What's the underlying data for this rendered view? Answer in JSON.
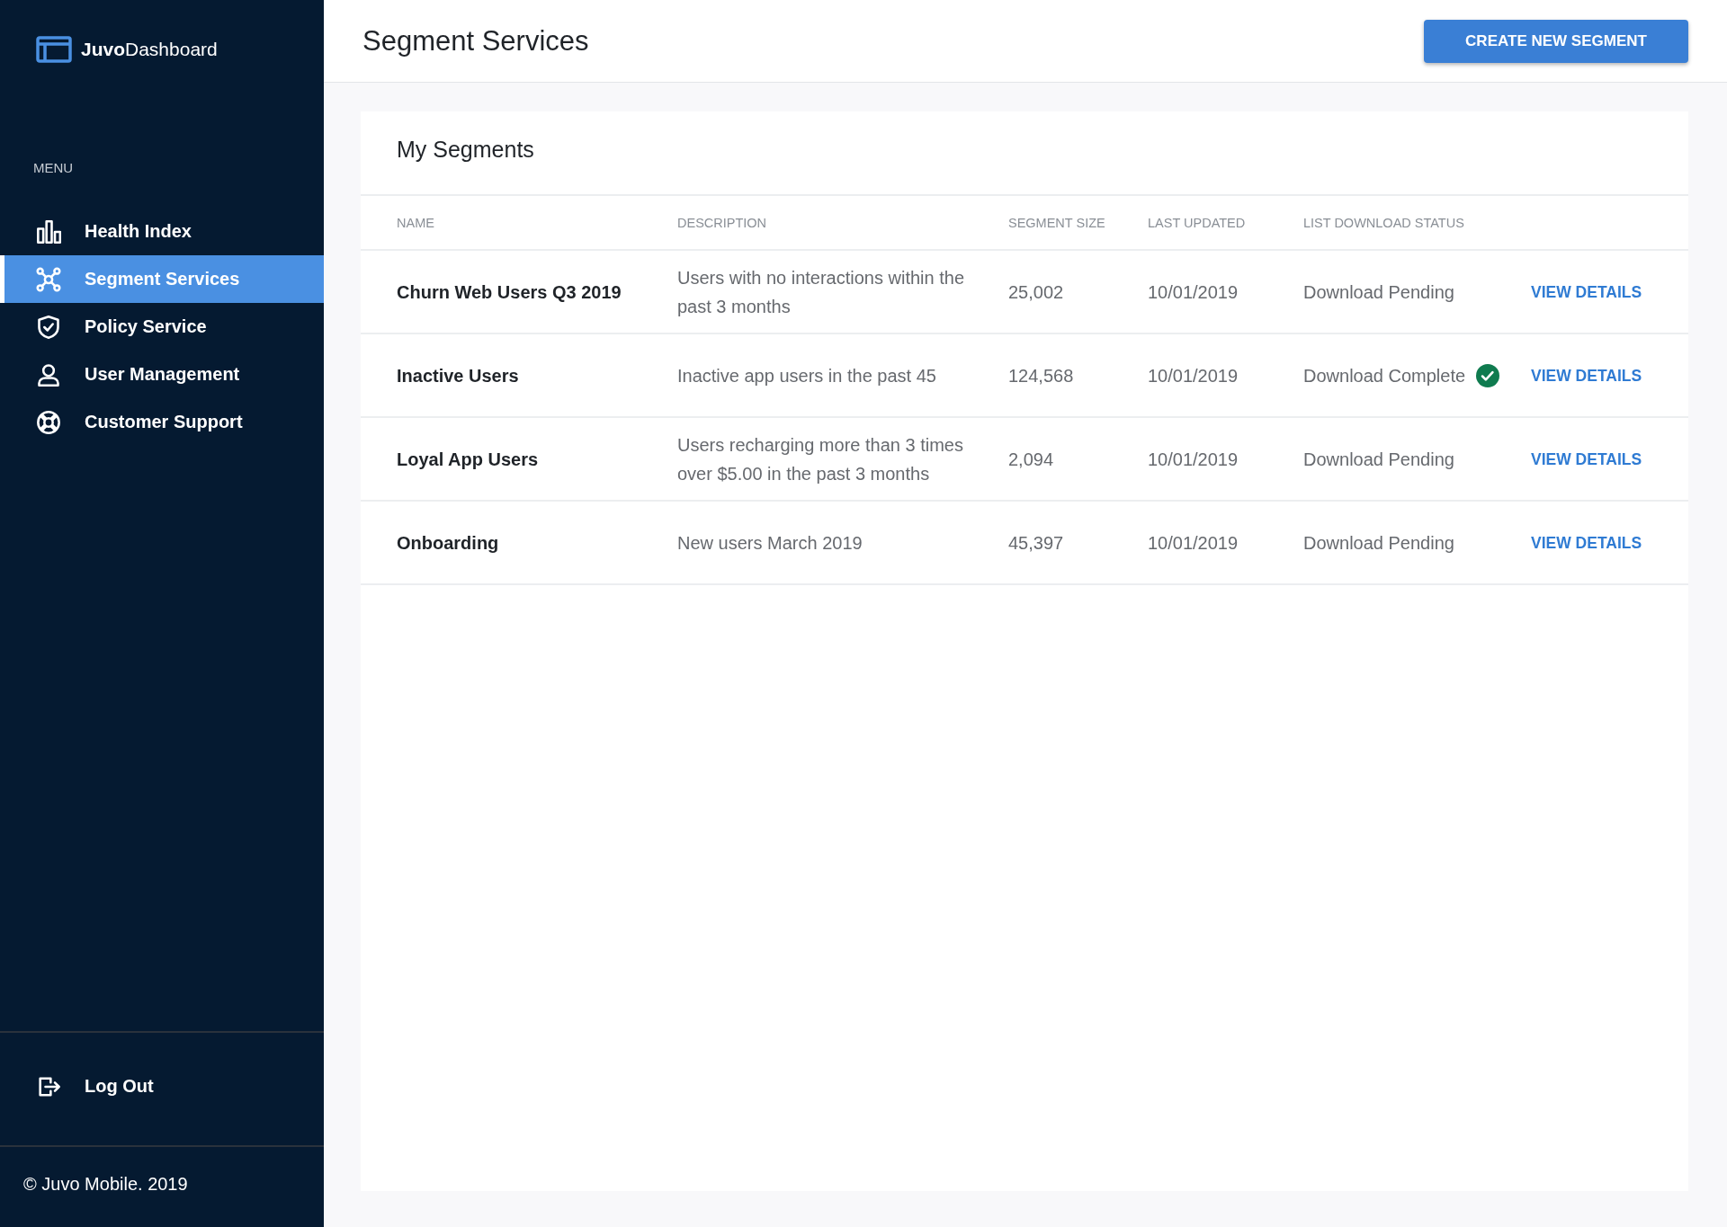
{
  "sidebar": {
    "logo": "**Juvo**Dashboard",
    "menu_label": "MENU",
    "items": [
      {
        "label": "Health Index",
        "kind": "bars",
        "selected": false
      },
      {
        "label": "Segment Services",
        "kind": "nodes",
        "selected": true
      },
      {
        "label": "Policy Service",
        "kind": "shield",
        "selected": false
      },
      {
        "label": "User Management",
        "kind": "user",
        "selected": false
      },
      {
        "label": "Customer Support",
        "kind": "lifebuoy",
        "selected": false
      }
    ],
    "logout": "Log Out",
    "footer": "© Juvo Mobile. 2019"
  },
  "header": {
    "title": "Segment Services",
    "button": "CREATE NEW SEGMENT"
  },
  "card": {
    "title": "My Segments",
    "columns": [
      "NAME",
      "DESCRIPTION",
      "SEGMENT SIZE",
      "LAST UPDATED",
      "LIST DOWNLOAD STATUS"
    ],
    "rows": [
      {
        "name": "Churn Web Users Q3 2019",
        "description": "Users with no interactions within the past 3 months",
        "size": "25,002",
        "updated": "10/01/2019",
        "status": "Download Pending",
        "complete": false,
        "action": "VIEW DETAILS"
      },
      {
        "name": "Inactive Users",
        "description": "Inactive app users in the past 45",
        "size": "124,568",
        "updated": "10/01/2019",
        "status": "Download Complete",
        "complete": true,
        "action": "VIEW DETAILS"
      },
      {
        "name": "Loyal App Users",
        "description": "Users recharging more than 3 times over $5.00 in the past 3 months",
        "size": "2,094",
        "updated": "10/01/2019",
        "status": "Download Pending",
        "complete": false,
        "action": "VIEW DETAILS"
      },
      {
        "name": "Onboarding",
        "description": "New users March 2019",
        "size": "45,397",
        "updated": "10/01/2019",
        "status": "Download Pending",
        "complete": false,
        "action": "VIEW DETAILS"
      }
    ]
  }
}
